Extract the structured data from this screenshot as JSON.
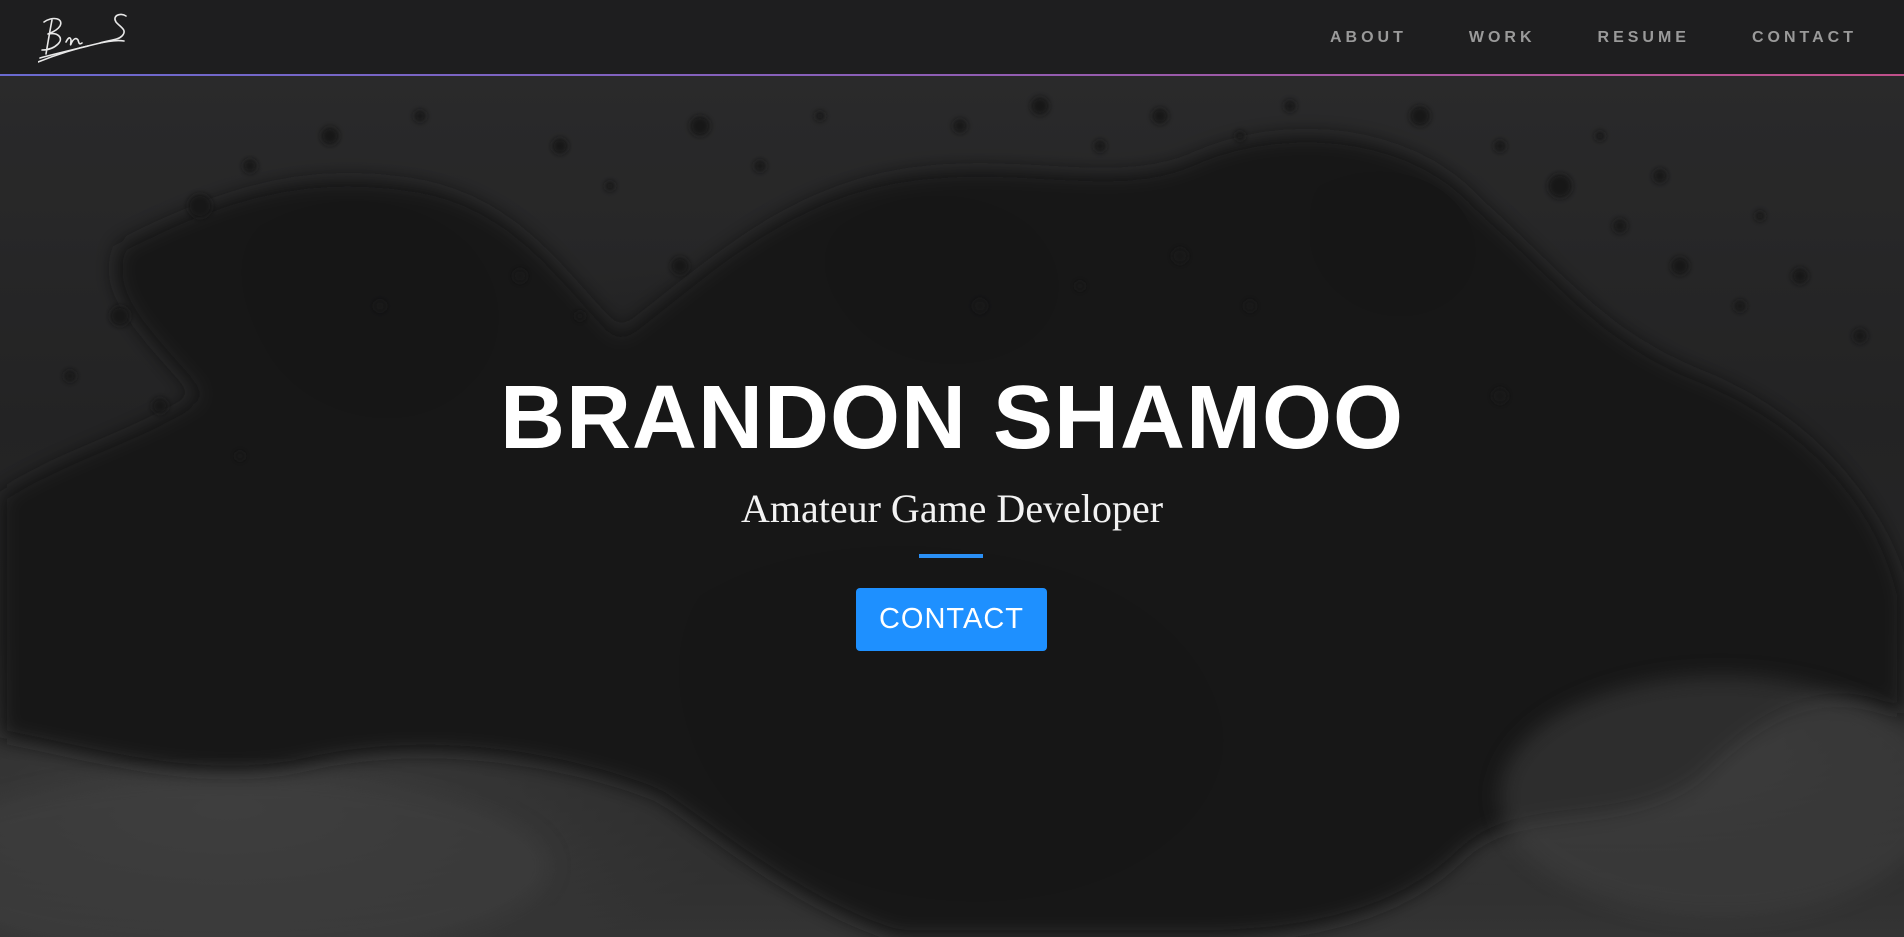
{
  "nav": {
    "logo_text": "BnS",
    "links": [
      {
        "label": "ABOUT"
      },
      {
        "label": "WORK"
      },
      {
        "label": "RESUME"
      },
      {
        "label": "CONTACT"
      }
    ]
  },
  "hero": {
    "title": "BRANDON SHAMOO",
    "subtitle": "Amateur Game Developer",
    "button_label": "CONTACT"
  },
  "colors": {
    "nav_bg": "#1e1e1f",
    "underline_start": "#6a6ad0",
    "underline_end": "#c0508a",
    "accent": "#1e90ff",
    "nav_link": "#9a9a9a"
  }
}
